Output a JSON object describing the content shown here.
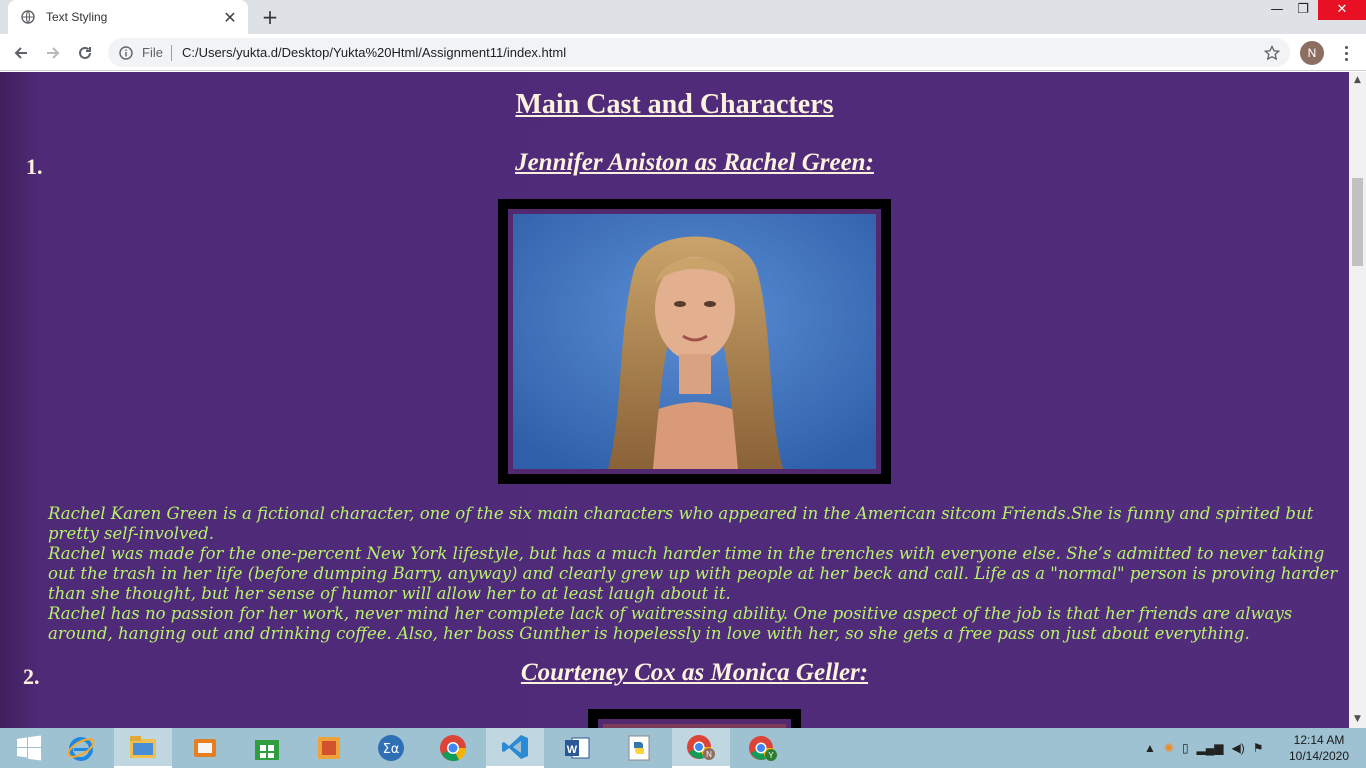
{
  "browser": {
    "tab_title": "Text Styling",
    "tab_close": "✕",
    "new_tab": "+",
    "window_controls": {
      "minimize": "—",
      "restore": "❐",
      "close": "✕"
    },
    "address": {
      "scheme_label": "File",
      "url": "C:/Users/yukta.d/Desktop/Yukta%20Html/Assignment11/index.html"
    },
    "profile_initial": "N"
  },
  "page": {
    "heading": "Main Cast and Characters",
    "characters": [
      {
        "number": "1.",
        "title": "Jennifer Aniston as Rachel Green:",
        "description": [
          "Rachel Karen Green is a fictional character, one of the six main characters who appeared in the American sitcom Friends.She is funny and spirited but pretty self-involved.",
          "Rachel was made for the one-percent New York lifestyle, but has a much harder time in the trenches with everyone else. She’s admitted to never taking out the trash in her life (before dumping Barry, anyway) and clearly grew up with people at her beck and call. Life as a \"normal\" person is proving harder than she thought, but her sense of humor will allow her to at least laugh about it.",
          "Rachel has no passion for her work, never mind her complete lack of waitressing ability. One positive aspect of the job is that her friends are always around, hanging out and drinking coffee. Also, her boss Gunther is hopelessly in love with her, so she gets a free pass on just about everything."
        ]
      },
      {
        "number": "2.",
        "title": "Courteney Cox as Monica Geller:"
      }
    ],
    "colors": {
      "background": "#4f2a77",
      "heading_text": "#fdf2dd",
      "body_text": "#b7f16a",
      "frame_border": "#000000"
    }
  },
  "taskbar": {
    "clock_time": "12:14 AM",
    "clock_date": "10/14/2020",
    "apps": [
      "start-icon",
      "internet-explorer-icon",
      "file-explorer-icon",
      "media-icon",
      "store-icon",
      "office-icon",
      "math-input-icon",
      "chrome-icon",
      "vscode-icon",
      "word-icon",
      "python-icon",
      "chrome-profile-n-icon",
      "chrome-profile-y-icon"
    ]
  }
}
